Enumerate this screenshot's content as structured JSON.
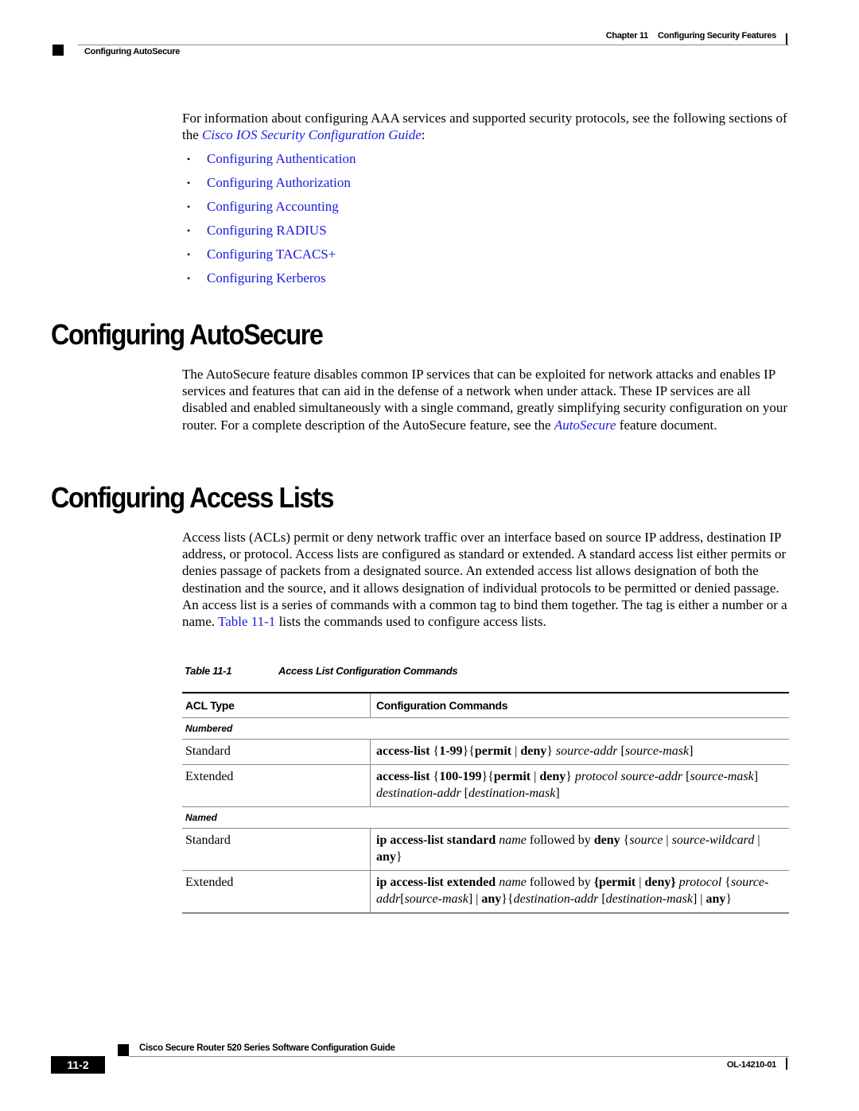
{
  "header": {
    "chapter_label": "Chapter 11",
    "chapter_title": "Configuring Security Features",
    "section_title": "Configuring AutoSecure"
  },
  "intro": {
    "text_before": "For information about configuring AAA services and supported security protocols, see the following sections of the ",
    "guide_link": "Cisco IOS Security Configuration Guide",
    "text_after": ":",
    "links": [
      "Configuring Authentication",
      "Configuring Authorization",
      "Configuring Accounting",
      "Configuring RADIUS",
      "Configuring TACACS+",
      "Configuring Kerberos"
    ],
    "bullet_glyph": "•"
  },
  "autosecure": {
    "heading": "Configuring AutoSecure",
    "text_before": "The AutoSecure feature disables common IP services that can be exploited for network attacks and enables IP services and features that can aid in the defense of a network when under attack. These IP services are all disabled and enabled simultaneously with a single command, greatly simplifying security configuration on your router. For a complete description of the AutoSecure feature, see the ",
    "link": "AutoSecure",
    "text_after": " feature document."
  },
  "access_lists": {
    "heading": "Configuring Access Lists",
    "text_before": "Access lists (ACLs) permit or deny network traffic over an interface based on source IP address, destination IP address, or protocol. Access lists are configured as standard or extended. A standard access list either permits or denies passage of packets from a designated source. An extended access list allows designation of both the destination and the source, and it allows designation of individual protocols to be permitted or denied passage. An access list is a series of commands with a common tag to bind them together. The tag is either a number or a name. ",
    "table_link": "Table 11-1",
    "text_after": " lists the commands used to configure access lists."
  },
  "table": {
    "caption_number": "Table 11-1",
    "caption_title": "Access List Configuration Commands",
    "columns": [
      "ACL Type",
      "Configuration Commands"
    ],
    "groups": [
      {
        "label": "Numbered",
        "rows": [
          {
            "type": "Standard",
            "command": [
              {
                "t": "access-list",
                "s": "b"
              },
              {
                "t": " {",
                "s": "n"
              },
              {
                "t": "1-99",
                "s": "b"
              },
              {
                "t": "}{",
                "s": "n"
              },
              {
                "t": "permit",
                "s": "b"
              },
              {
                "t": " | ",
                "s": "n"
              },
              {
                "t": "deny",
                "s": "b"
              },
              {
                "t": "} ",
                "s": "n"
              },
              {
                "t": "source-addr",
                "s": "i"
              },
              {
                "t": " [",
                "s": "n"
              },
              {
                "t": "source-mask",
                "s": "i"
              },
              {
                "t": "]",
                "s": "n"
              }
            ]
          },
          {
            "type": "Extended",
            "command": [
              {
                "t": "access-list",
                "s": "b"
              },
              {
                "t": " {",
                "s": "n"
              },
              {
                "t": "100-199",
                "s": "b"
              },
              {
                "t": "}{",
                "s": "n"
              },
              {
                "t": "permit",
                "s": "b"
              },
              {
                "t": " | ",
                "s": "n"
              },
              {
                "t": "deny",
                "s": "b"
              },
              {
                "t": "} ",
                "s": "n"
              },
              {
                "t": "protocol source-addr",
                "s": "i"
              },
              {
                "t": " [",
                "s": "n"
              },
              {
                "t": "source-mask",
                "s": "i"
              },
              {
                "t": "] ",
                "s": "n"
              },
              {
                "t": "destination-addr",
                "s": "i"
              },
              {
                "t": " [",
                "s": "n"
              },
              {
                "t": "destination-mask",
                "s": "i"
              },
              {
                "t": "]",
                "s": "n"
              }
            ]
          }
        ]
      },
      {
        "label": "Named",
        "rows": [
          {
            "type": "Standard",
            "command": [
              {
                "t": "ip access-list standard",
                "s": "b"
              },
              {
                "t": " ",
                "s": "n"
              },
              {
                "t": "name",
                "s": "i"
              },
              {
                "t": " followed by ",
                "s": "n"
              },
              {
                "t": "deny",
                "s": "b"
              },
              {
                "t": " {",
                "s": "n"
              },
              {
                "t": "source",
                "s": "i"
              },
              {
                "t": " | ",
                "s": "n"
              },
              {
                "t": "source-wildcard",
                "s": "i"
              },
              {
                "t": " | ",
                "s": "n"
              },
              {
                "t": "any",
                "s": "b"
              },
              {
                "t": "}",
                "s": "n"
              }
            ]
          },
          {
            "type": "Extended",
            "command": [
              {
                "t": "ip access-list extended",
                "s": "b"
              },
              {
                "t": " ",
                "s": "n"
              },
              {
                "t": "name",
                "s": "i"
              },
              {
                "t": " followed by ",
                "s": "n"
              },
              {
                "t": "{permit",
                "s": "b"
              },
              {
                "t": " | ",
                "s": "n"
              },
              {
                "t": "deny}",
                "s": "b"
              },
              {
                "t": " ",
                "s": "n"
              },
              {
                "t": "protocol",
                "s": "i"
              },
              {
                "t": " {",
                "s": "n"
              },
              {
                "t": "source-addr",
                "s": "i"
              },
              {
                "t": "[",
                "s": "n"
              },
              {
                "t": "source-mask",
                "s": "i"
              },
              {
                "t": "] | ",
                "s": "n"
              },
              {
                "t": "any",
                "s": "b"
              },
              {
                "t": "}{",
                "s": "n"
              },
              {
                "t": "destination-addr",
                "s": "i"
              },
              {
                "t": " [",
                "s": "n"
              },
              {
                "t": "destination-mask",
                "s": "i"
              },
              {
                "t": "] | ",
                "s": "n"
              },
              {
                "t": "any",
                "s": "b"
              },
              {
                "t": "}",
                "s": "n"
              }
            ]
          }
        ]
      }
    ]
  },
  "footer": {
    "guide_title": "Cisco Secure Router 520 Series Software Configuration Guide",
    "page_number": "11-2",
    "doc_number": "OL-14210-01"
  },
  "colors": {
    "link": "#1a1adf",
    "rule": "#8a8a8a",
    "text": "#000000"
  }
}
